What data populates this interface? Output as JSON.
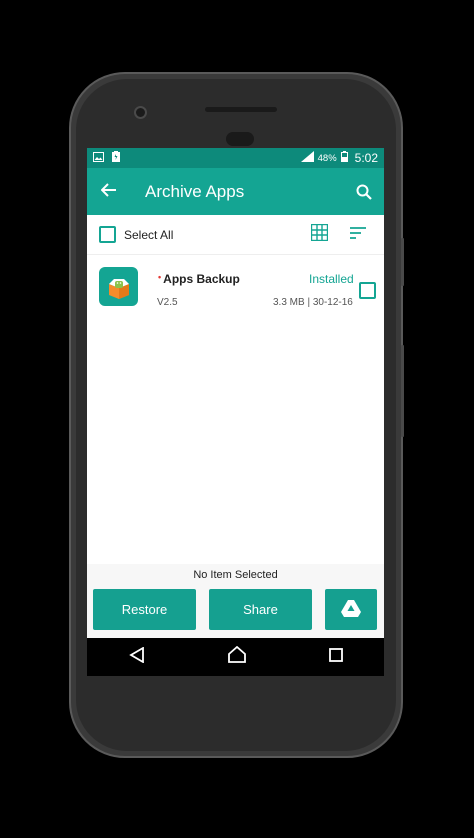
{
  "status_bar": {
    "battery": "48%",
    "time": "5:02"
  },
  "app_bar": {
    "title": "Archive Apps"
  },
  "toolbar": {
    "select_all_label": "Select All"
  },
  "apps": [
    {
      "name": "Apps Backup",
      "version": "V2.5",
      "status": "Installed",
      "meta": "3.3 MB | 30-12-16"
    }
  ],
  "footer": {
    "selection_text": "No Item Selected",
    "restore_label": "Restore",
    "share_label": "Share"
  },
  "colors": {
    "accent": "#14a593",
    "status_bar": "#0d8a7b"
  },
  "icons": [
    "image-icon",
    "battery-charging-icon",
    "signal-icon",
    "battery-icon",
    "back-arrow-icon",
    "search-icon",
    "grid-view-icon",
    "sort-icon",
    "app-icon",
    "drive-icon",
    "nav-back-icon",
    "nav-home-icon",
    "nav-recents-icon"
  ]
}
